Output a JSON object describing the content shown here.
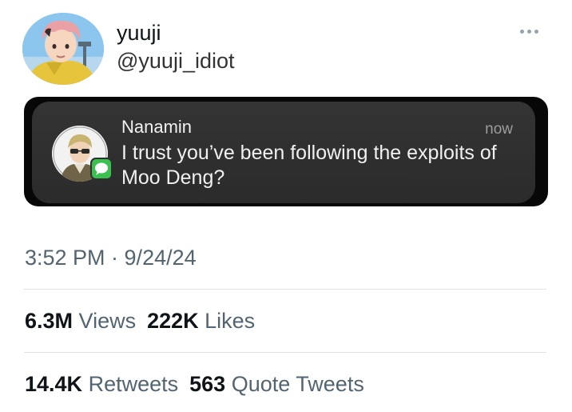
{
  "author": {
    "name": "yuuji",
    "handle": "@yuuji_idiot"
  },
  "notification": {
    "sender": "Nanamin",
    "time": "now",
    "message": "I trust you’ve been following the exploits of Moo Deng?"
  },
  "tweet": {
    "timestamp": "3:52 PM · 9/24/24"
  },
  "stats": {
    "views_count": "6.3M",
    "views_label": "Views",
    "likes_count": "222K",
    "likes_label": "Likes",
    "retweets_count": "14.4K",
    "retweets_label": "Retweets",
    "quotes_count": "563",
    "quotes_label": "Quote Tweets"
  },
  "icons": {
    "more": "more-dots-icon",
    "message_badge": "messages-app-icon"
  },
  "colors": {
    "muted_text": "#536471",
    "primary_text": "#0f1419",
    "notification_bg": "#303030",
    "message_green": "#3ac04f"
  }
}
